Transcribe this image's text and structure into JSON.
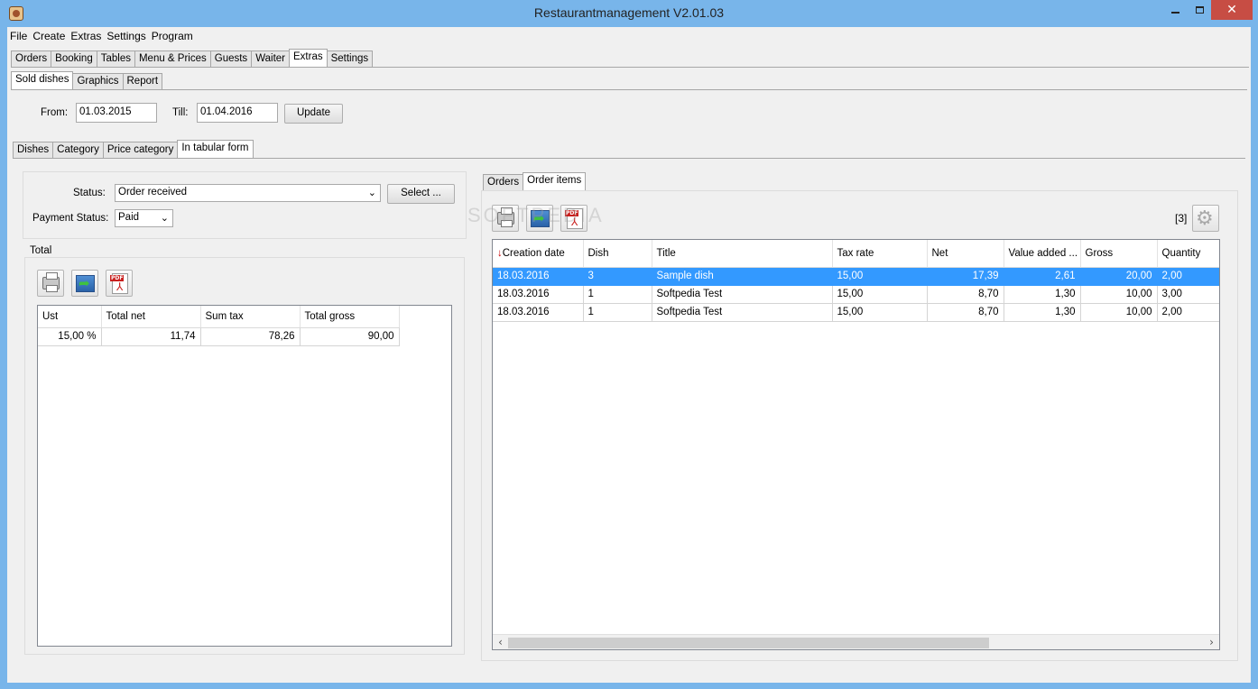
{
  "window": {
    "title": "Restaurantmanagement V2.01.03"
  },
  "menu": [
    "File",
    "Create",
    "Extras",
    "Settings",
    "Program"
  ],
  "main_tabs": [
    "Orders",
    "Booking",
    "Tables",
    "Menu & Prices",
    "Guests",
    "Waiter",
    "Extras",
    "Settings"
  ],
  "extras_tabs": [
    "Sold dishes",
    "Graphics",
    "Report"
  ],
  "filter": {
    "from_label": "From:",
    "from_value": "01.03.2015",
    "till_label": "Till:",
    "till_value": "01.04.2016",
    "update_label": "Update"
  },
  "view_tabs": [
    "Dishes",
    "Category",
    "Price category",
    "In tabular form"
  ],
  "status": {
    "status_label": "Status:",
    "status_value": "Order received",
    "select_label": "Select ...",
    "payment_label": "Payment Status:",
    "payment_value": "Paid"
  },
  "total": {
    "group_title": "Total",
    "columns": [
      "Ust",
      "Total net",
      "Sum tax",
      "Total gross"
    ],
    "rows": [
      [
        "15,00 %",
        "11,74",
        "78,26",
        "90,00"
      ]
    ]
  },
  "right_tabs": [
    "Orders",
    "Order items"
  ],
  "watermark": "SOFTPEDIA",
  "items": {
    "count_badge": "[3]",
    "sort_indicator": "↓",
    "columns": [
      "Creation date",
      "Dish",
      "Title",
      "Tax rate",
      "Net",
      "Value added ...",
      "Gross",
      "Quantity"
    ],
    "rows": [
      [
        "18.03.2016",
        "3",
        "Sample dish",
        "15,00",
        "17,39",
        "2,61",
        "20,00",
        "2,00"
      ],
      [
        "18.03.2016",
        "1",
        "Softpedia Test",
        "15,00",
        "8,70",
        "1,30",
        "10,00",
        "3,00"
      ],
      [
        "18.03.2016",
        "1",
        "Softpedia Test",
        "15,00",
        "8,70",
        "1,30",
        "10,00",
        "2,00"
      ]
    ],
    "selected_row": 0
  },
  "icons": [
    "print-icon",
    "export-icon",
    "pdf-icon",
    "gear-icon"
  ],
  "colors": {
    "title_bar": "#78b5ea",
    "selection": "#3399ff",
    "close_button": "#c74d44"
  }
}
